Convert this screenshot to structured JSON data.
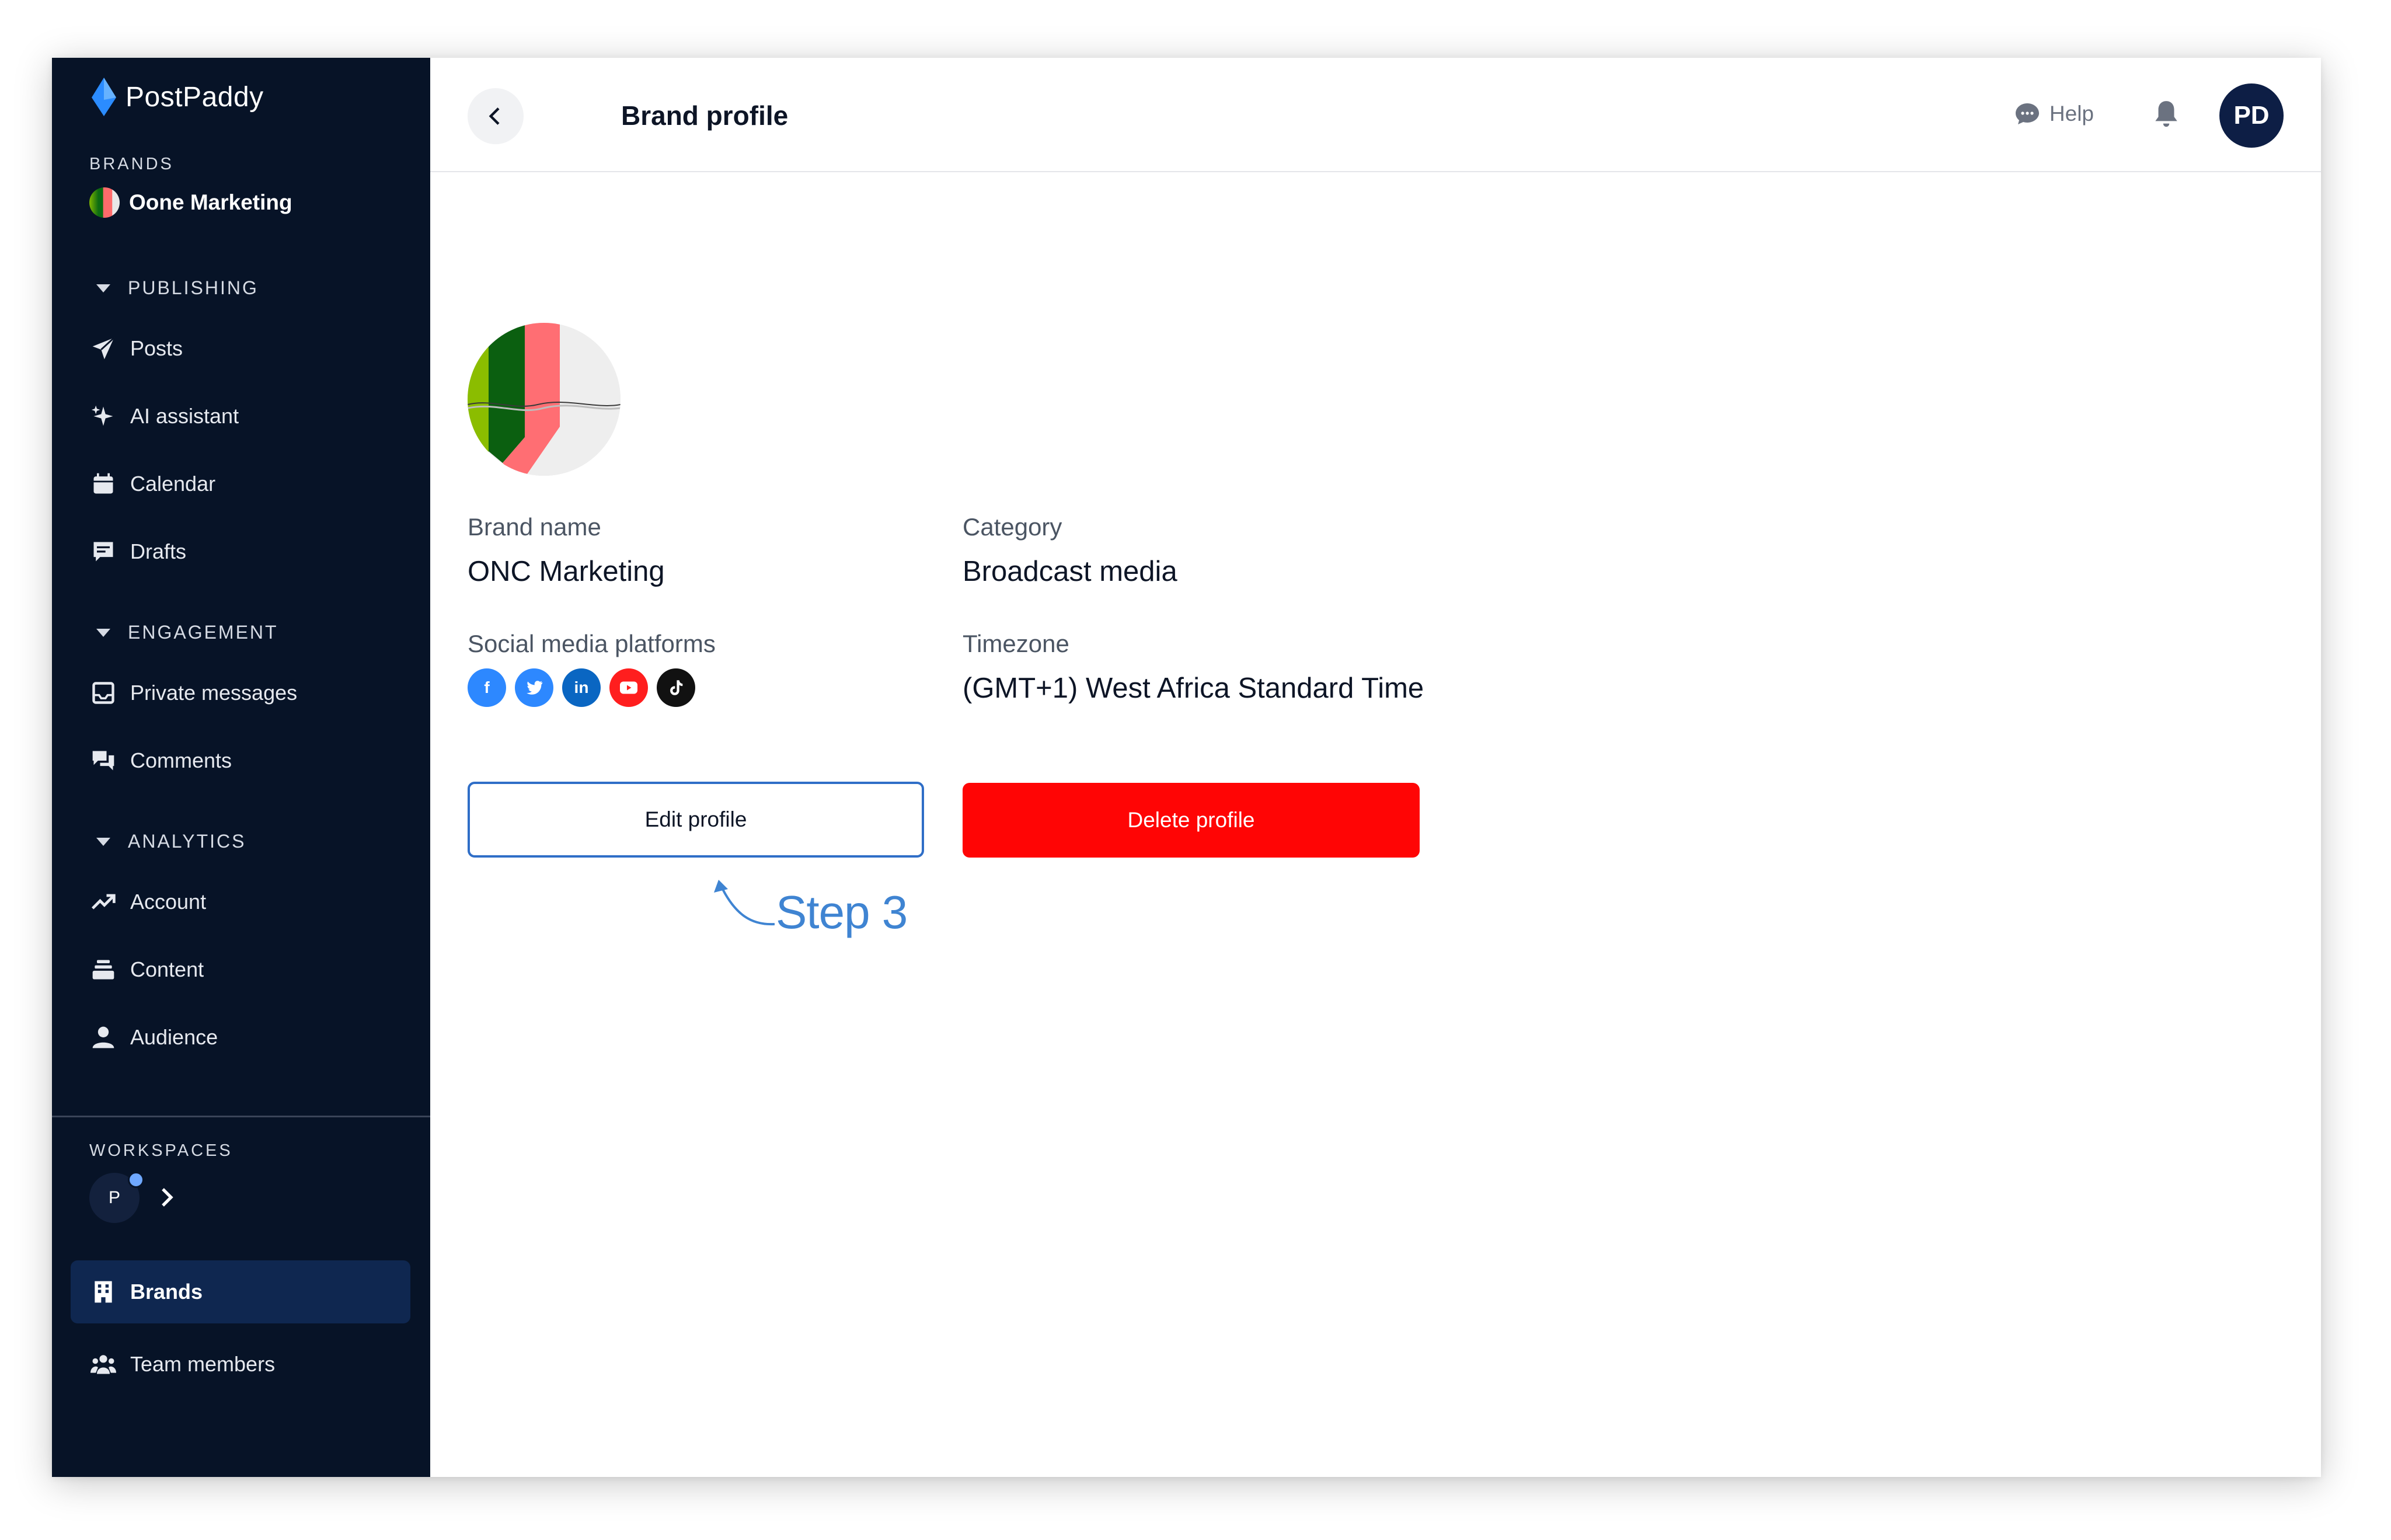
{
  "app": {
    "name": "PostPaddy"
  },
  "sidebar": {
    "brands_label": "BRANDS",
    "current_brand": "Oone Marketing",
    "groups": [
      {
        "title": "PUBLISHING",
        "items": [
          {
            "label": "Posts",
            "icon": "send-icon"
          },
          {
            "label": "AI assistant",
            "icon": "sparkle-icon"
          },
          {
            "label": "Calendar",
            "icon": "calendar-icon"
          },
          {
            "label": "Drafts",
            "icon": "drafts-icon"
          }
        ]
      },
      {
        "title": "ENGAGEMENT",
        "items": [
          {
            "label": "Private messages",
            "icon": "inbox-icon"
          },
          {
            "label": "Comments",
            "icon": "comments-icon"
          }
        ]
      },
      {
        "title": "ANALYTICS",
        "items": [
          {
            "label": "Account",
            "icon": "trend-icon"
          },
          {
            "label": "Content",
            "icon": "stack-icon"
          },
          {
            "label": "Audience",
            "icon": "person-icon"
          }
        ]
      }
    ],
    "workspaces_label": "WORKSPACES",
    "workspace_initial": "P",
    "bottom_items": [
      {
        "label": "Brands",
        "icon": "building-icon",
        "active": true
      },
      {
        "label": "Team members",
        "icon": "team-icon",
        "active": false
      }
    ]
  },
  "header": {
    "title": "Brand profile",
    "help_label": "Help",
    "user_initials": "PD"
  },
  "profile": {
    "brand_name_label": "Brand name",
    "brand_name": "ONC Marketing",
    "category_label": "Category",
    "category": "Broadcast media",
    "social_label": "Social media platforms",
    "socials": [
      {
        "name": "facebook-icon",
        "glyph": "f",
        "color": "#2d88ff"
      },
      {
        "name": "twitter-icon",
        "glyph": "",
        "color": "#2d88ff"
      },
      {
        "name": "linkedin-icon",
        "glyph": "in",
        "color": "#0a66c2"
      },
      {
        "name": "youtube-icon",
        "glyph": "",
        "color": "#ff1e1e"
      },
      {
        "name": "tiktok-icon",
        "glyph": "",
        "color": "#111111"
      }
    ],
    "timezone_label": "Timezone",
    "timezone": "(GMT+1) West Africa Standard Time"
  },
  "actions": {
    "edit_label": "Edit profile",
    "delete_label": "Delete profile"
  },
  "annotation": {
    "text": "Step 3"
  },
  "colors": {
    "sidebar": "#071327",
    "active": "#0f2750",
    "danger": "#ff0505",
    "accent": "#2f6ec7"
  }
}
